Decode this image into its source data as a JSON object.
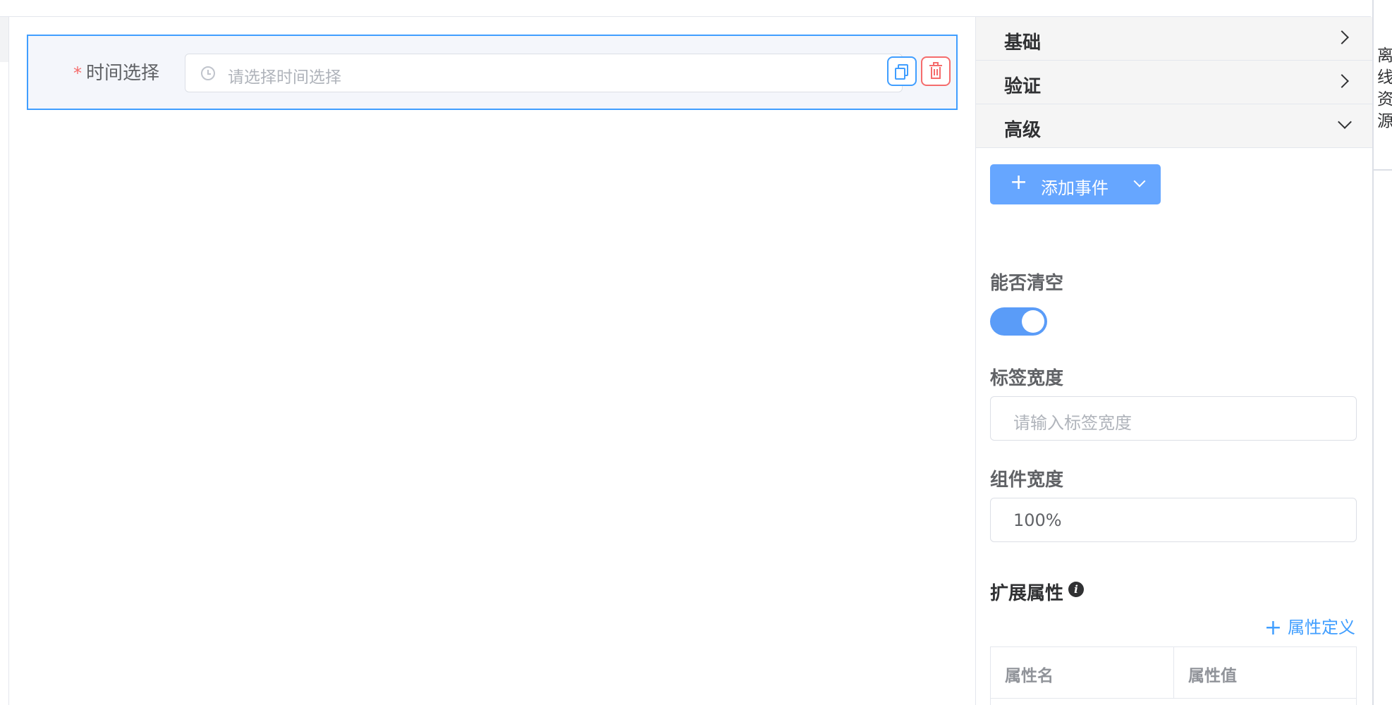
{
  "canvas": {
    "form_item": {
      "required_mark": "*",
      "label": "时间选择",
      "placeholder": "请选择时间选择",
      "icon": "clock-icon"
    },
    "toolbar": {
      "copy_icon": "copy-icon",
      "delete_icon": "trash-icon"
    }
  },
  "panel": {
    "sections": [
      {
        "title": "基础",
        "state": "collapsed"
      },
      {
        "title": "验证",
        "state": "collapsed"
      },
      {
        "title": "高级",
        "state": "expanded"
      }
    ],
    "add_event": {
      "label": "添加事件",
      "icon": "plus-icon"
    },
    "clearable": {
      "label": "能否清空",
      "value": true
    },
    "label_width": {
      "label": "标签宽度",
      "placeholder": "请输入标签宽度",
      "value": ""
    },
    "component_width": {
      "label": "组件宽度",
      "value": "100%"
    },
    "ext_props": {
      "label": "扩展属性",
      "info_icon": "info-icon",
      "define_label": "属性定义",
      "columns": [
        "属性名",
        "属性值"
      ]
    }
  },
  "side_tab": {
    "label": "离线资源"
  },
  "colors": {
    "accent": "#409eff",
    "danger": "#f56c6c",
    "switch_on": "#5a9cf8"
  }
}
